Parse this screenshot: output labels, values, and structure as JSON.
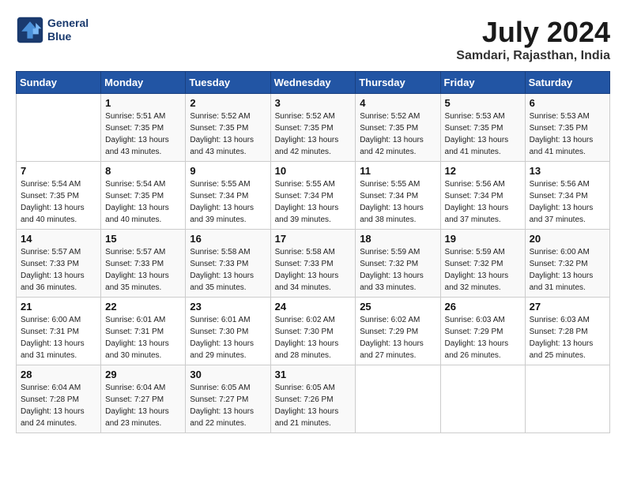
{
  "header": {
    "logo_line1": "General",
    "logo_line2": "Blue",
    "title": "July 2024",
    "subtitle": "Samdari, Rajasthan, India"
  },
  "calendar": {
    "days_of_week": [
      "Sunday",
      "Monday",
      "Tuesday",
      "Wednesday",
      "Thursday",
      "Friday",
      "Saturday"
    ],
    "weeks": [
      [
        {
          "day": "",
          "detail": ""
        },
        {
          "day": "1",
          "detail": "Sunrise: 5:51 AM\nSunset: 7:35 PM\nDaylight: 13 hours\nand 43 minutes."
        },
        {
          "day": "2",
          "detail": "Sunrise: 5:52 AM\nSunset: 7:35 PM\nDaylight: 13 hours\nand 43 minutes."
        },
        {
          "day": "3",
          "detail": "Sunrise: 5:52 AM\nSunset: 7:35 PM\nDaylight: 13 hours\nand 42 minutes."
        },
        {
          "day": "4",
          "detail": "Sunrise: 5:52 AM\nSunset: 7:35 PM\nDaylight: 13 hours\nand 42 minutes."
        },
        {
          "day": "5",
          "detail": "Sunrise: 5:53 AM\nSunset: 7:35 PM\nDaylight: 13 hours\nand 41 minutes."
        },
        {
          "day": "6",
          "detail": "Sunrise: 5:53 AM\nSunset: 7:35 PM\nDaylight: 13 hours\nand 41 minutes."
        }
      ],
      [
        {
          "day": "7",
          "detail": "Sunrise: 5:54 AM\nSunset: 7:35 PM\nDaylight: 13 hours\nand 40 minutes."
        },
        {
          "day": "8",
          "detail": "Sunrise: 5:54 AM\nSunset: 7:35 PM\nDaylight: 13 hours\nand 40 minutes."
        },
        {
          "day": "9",
          "detail": "Sunrise: 5:55 AM\nSunset: 7:34 PM\nDaylight: 13 hours\nand 39 minutes."
        },
        {
          "day": "10",
          "detail": "Sunrise: 5:55 AM\nSunset: 7:34 PM\nDaylight: 13 hours\nand 39 minutes."
        },
        {
          "day": "11",
          "detail": "Sunrise: 5:55 AM\nSunset: 7:34 PM\nDaylight: 13 hours\nand 38 minutes."
        },
        {
          "day": "12",
          "detail": "Sunrise: 5:56 AM\nSunset: 7:34 PM\nDaylight: 13 hours\nand 37 minutes."
        },
        {
          "day": "13",
          "detail": "Sunrise: 5:56 AM\nSunset: 7:34 PM\nDaylight: 13 hours\nand 37 minutes."
        }
      ],
      [
        {
          "day": "14",
          "detail": "Sunrise: 5:57 AM\nSunset: 7:33 PM\nDaylight: 13 hours\nand 36 minutes."
        },
        {
          "day": "15",
          "detail": "Sunrise: 5:57 AM\nSunset: 7:33 PM\nDaylight: 13 hours\nand 35 minutes."
        },
        {
          "day": "16",
          "detail": "Sunrise: 5:58 AM\nSunset: 7:33 PM\nDaylight: 13 hours\nand 35 minutes."
        },
        {
          "day": "17",
          "detail": "Sunrise: 5:58 AM\nSunset: 7:33 PM\nDaylight: 13 hours\nand 34 minutes."
        },
        {
          "day": "18",
          "detail": "Sunrise: 5:59 AM\nSunset: 7:32 PM\nDaylight: 13 hours\nand 33 minutes."
        },
        {
          "day": "19",
          "detail": "Sunrise: 5:59 AM\nSunset: 7:32 PM\nDaylight: 13 hours\nand 32 minutes."
        },
        {
          "day": "20",
          "detail": "Sunrise: 6:00 AM\nSunset: 7:32 PM\nDaylight: 13 hours\nand 31 minutes."
        }
      ],
      [
        {
          "day": "21",
          "detail": "Sunrise: 6:00 AM\nSunset: 7:31 PM\nDaylight: 13 hours\nand 31 minutes."
        },
        {
          "day": "22",
          "detail": "Sunrise: 6:01 AM\nSunset: 7:31 PM\nDaylight: 13 hours\nand 30 minutes."
        },
        {
          "day": "23",
          "detail": "Sunrise: 6:01 AM\nSunset: 7:30 PM\nDaylight: 13 hours\nand 29 minutes."
        },
        {
          "day": "24",
          "detail": "Sunrise: 6:02 AM\nSunset: 7:30 PM\nDaylight: 13 hours\nand 28 minutes."
        },
        {
          "day": "25",
          "detail": "Sunrise: 6:02 AM\nSunset: 7:29 PM\nDaylight: 13 hours\nand 27 minutes."
        },
        {
          "day": "26",
          "detail": "Sunrise: 6:03 AM\nSunset: 7:29 PM\nDaylight: 13 hours\nand 26 minutes."
        },
        {
          "day": "27",
          "detail": "Sunrise: 6:03 AM\nSunset: 7:28 PM\nDaylight: 13 hours\nand 25 minutes."
        }
      ],
      [
        {
          "day": "28",
          "detail": "Sunrise: 6:04 AM\nSunset: 7:28 PM\nDaylight: 13 hours\nand 24 minutes."
        },
        {
          "day": "29",
          "detail": "Sunrise: 6:04 AM\nSunset: 7:27 PM\nDaylight: 13 hours\nand 23 minutes."
        },
        {
          "day": "30",
          "detail": "Sunrise: 6:05 AM\nSunset: 7:27 PM\nDaylight: 13 hours\nand 22 minutes."
        },
        {
          "day": "31",
          "detail": "Sunrise: 6:05 AM\nSunset: 7:26 PM\nDaylight: 13 hours\nand 21 minutes."
        },
        {
          "day": "",
          "detail": ""
        },
        {
          "day": "",
          "detail": ""
        },
        {
          "day": "",
          "detail": ""
        }
      ]
    ]
  }
}
